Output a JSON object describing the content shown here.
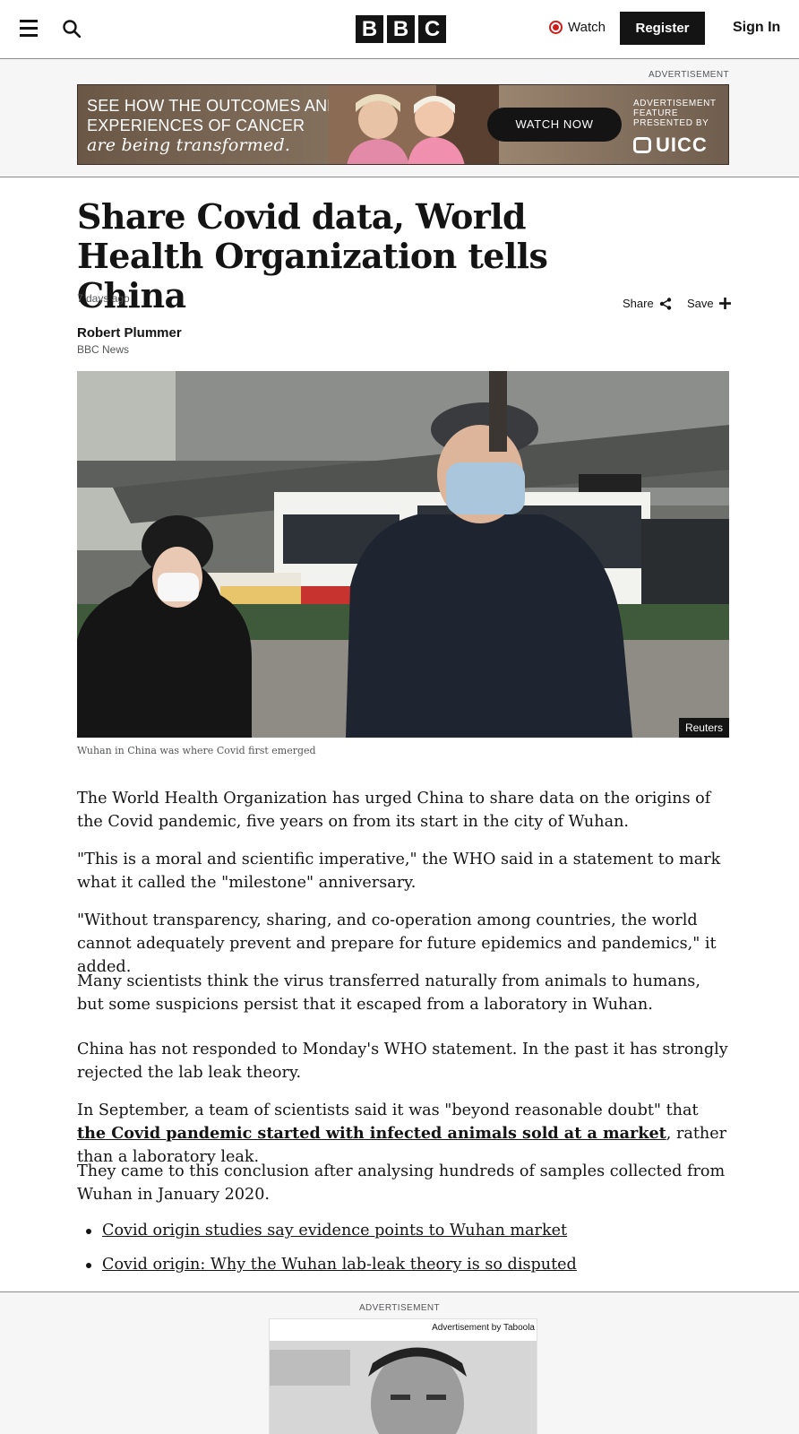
{
  "header": {
    "logo_letters": [
      "B",
      "B",
      "C"
    ],
    "watch_label": "Watch",
    "register_label": "Register",
    "signin_label": "Sign In",
    "icons": [
      "menu-icon",
      "search-icon",
      "watch-live-icon"
    ]
  },
  "top_ad": {
    "label": "ADVERTISEMENT",
    "headline_line1": "SEE HOW THE OUTCOMES AND",
    "headline_line2": "EXPERIENCES OF CANCER",
    "headline_script": "are being transformed.",
    "cta": "WATCH NOW",
    "sponsor_line1": "ADVERTISEMENT",
    "sponsor_line2": "FEATURE",
    "sponsor_line3": "PRESENTED BY",
    "brand": "UICC"
  },
  "article": {
    "headline": "Share Covid data, World Health Organization tells China",
    "time": "7 days ago",
    "share_label": "Share",
    "save_label": "Save",
    "author": "Robert Plummer",
    "org": "BBC News",
    "image_credit": "Reuters",
    "caption": "Wuhan in China was where Covid first emerged",
    "paragraphs": [
      "The World Health Organization has urged China to share data on the origins of the Covid pandemic, five years on from its start in the city of Wuhan.",
      "\"This is a moral and scientific imperative,\" the WHO said in a statement to mark what it called the \"milestone\" anniversary.",
      "\"Without transparency, sharing, and co-operation among countries, the world cannot adequately prevent and prepare for future epidemics and pandemics,\" it added.",
      "Many scientists think the virus transferred naturally from animals to humans, but some suspicions persist that it escaped from a laboratory in Wuhan.",
      "China has not responded to Monday's WHO statement. In the past it has strongly rejected the lab leak theory."
    ],
    "p6_before": "In September, a team of scientists said it was \"beyond reasonable doubt\" that ",
    "p6_link": "the Covid pandemic started with infected animals sold at a market",
    "p6_after": ", rather than a laboratory leak.",
    "p7": "They came to this conclusion after analysing hundreds of samples collected from Wuhan in January 2020.",
    "related_links": [
      "Covid origin studies say evidence points to Wuhan market",
      "Covid origin: Why the Wuhan lab-leak theory is so disputed"
    ]
  },
  "bottom_ad": {
    "label": "ADVERTISEMENT",
    "by": "Advertisement by Taboola"
  },
  "colors": {
    "text": "#141414",
    "secondary": "#545658",
    "live_red": "#d01b1b",
    "ad_background": "#f6f6f6"
  }
}
